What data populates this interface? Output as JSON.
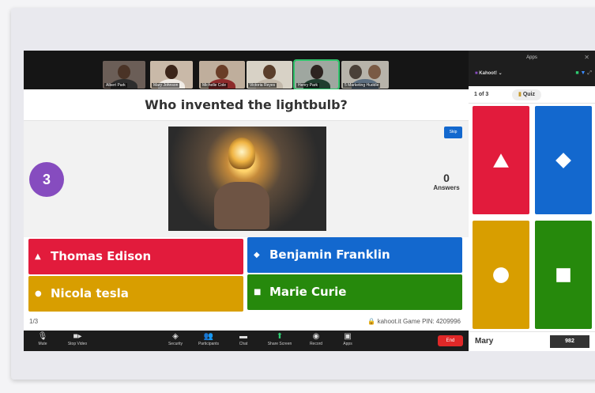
{
  "gallery": {
    "participants": [
      {
        "name": "Albert Park"
      },
      {
        "name": "Mary Johnson"
      },
      {
        "name": "Michelle Cole"
      },
      {
        "name": "Victoria Reyes"
      },
      {
        "name": "Henry Park"
      },
      {
        "name": "5 Marketing Huddle"
      }
    ]
  },
  "game": {
    "question": "Who invented the lightbulb?",
    "timer": "3",
    "skip_label": "Skip",
    "answer_count": "0",
    "answers_label": "Answers",
    "answers": [
      {
        "text": "Thomas Edison",
        "color": "#e21b3c",
        "shape": "triangle"
      },
      {
        "text": "Benjamin Franklin",
        "color": "#1368ce",
        "shape": "diamond"
      },
      {
        "text": "Nicola tesla",
        "color": "#d89e00",
        "shape": "circle"
      },
      {
        "text": "Marie Curie",
        "color": "#26890c",
        "shape": "square"
      }
    ],
    "page": "1/3",
    "footer_info": "kahoot.it  Game PIN: 4209996"
  },
  "toolbar": {
    "mute": "Mute",
    "stop_video": "Stop Video",
    "security": "Security",
    "participants": "Participants",
    "chat": "Chat",
    "share_screen": "Share Screen",
    "record": "Record",
    "apps": "Apps",
    "end": "End"
  },
  "panel": {
    "title": "Apps",
    "app_name": "Kahoot!",
    "progress": "1 of 3",
    "quiz_label": "Quiz",
    "player_name": "Mary",
    "player_score": "982"
  }
}
